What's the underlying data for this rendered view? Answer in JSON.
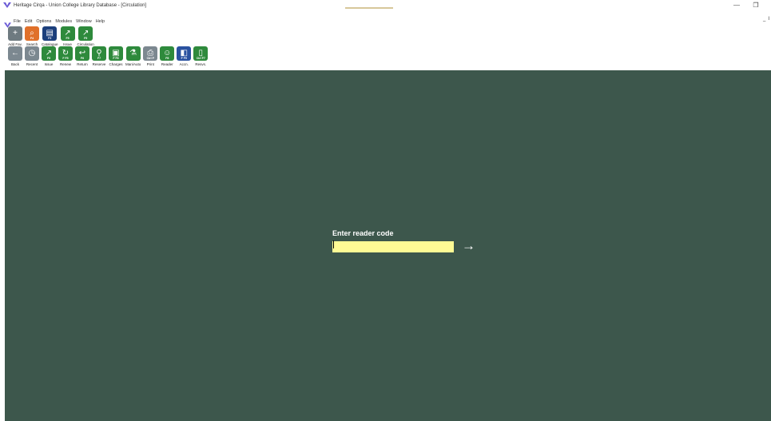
{
  "window": {
    "title": "Heritage Cirqa - Union College Library Database - [Circulation]",
    "app_icon": "heritage-logo-icon",
    "controls": {
      "minimize": "—",
      "restore": "❐"
    },
    "title_progress": 0.5
  },
  "menu": {
    "items": [
      "File",
      "Edit",
      "Options",
      "Modules",
      "Window",
      "Help"
    ],
    "mdi_controls": {
      "minimize": "_",
      "close": "I"
    }
  },
  "toolbar_main": [
    {
      "label": "Add Fav.",
      "key": "",
      "icon": "add-favourite-icon",
      "glyph": "+",
      "color": "grey"
    },
    {
      "label": "Search",
      "key": "F4",
      "icon": "search-icon",
      "glyph": "⌕",
      "color": "orange"
    },
    {
      "label": "Catalogue",
      "key": "F2",
      "icon": "catalogue-book-icon",
      "glyph": "▤",
      "color": "navy"
    },
    {
      "label": "Issue",
      "key": "F5",
      "icon": "issue-arrow-icon",
      "glyph": "↗",
      "color": "green"
    },
    {
      "label": "Circulation",
      "key": "F5",
      "icon": "circulation-arrow-icon",
      "glyph": "↗",
      "color": "green"
    }
  ],
  "toolbar_circ": [
    {
      "label": "Back",
      "key": "",
      "icon": "back-arrow-icon",
      "glyph": "←",
      "color": "slate"
    },
    {
      "label": "Recent",
      "key": "",
      "icon": "recent-clock-icon",
      "glyph": "◷",
      "color": "slate"
    },
    {
      "label": "Issue",
      "key": "F5",
      "icon": "issue-arrow-icon",
      "glyph": "↗",
      "color": "green"
    },
    {
      "label": "Renew",
      "key": "F F5",
      "icon": "renew-icon",
      "glyph": "↻",
      "color": "green"
    },
    {
      "label": "Return",
      "key": "F6",
      "icon": "return-icon",
      "glyph": "↩",
      "color": "green"
    },
    {
      "label": "Reserve",
      "key": "F7",
      "icon": "reserve-pin-icon",
      "glyph": "⚲",
      "color": "green"
    },
    {
      "label": "Charges",
      "key": "F F6",
      "icon": "charges-wallet-icon",
      "glyph": "▣",
      "color": "green"
    },
    {
      "label": "Man/Auto",
      "key": "",
      "icon": "man-auto-flask-icon",
      "glyph": "⚗",
      "color": "green"
    },
    {
      "label": "Print",
      "key": "Ctrl P",
      "icon": "print-icon",
      "glyph": "⎙",
      "color": "slate"
    },
    {
      "label": "Reader",
      "key": "F8",
      "icon": "reader-person-icon",
      "glyph": "☺",
      "color": "green"
    },
    {
      "label": "Accn.",
      "key": "F F9",
      "icon": "accession-icon",
      "glyph": "◧",
      "color": "blue"
    },
    {
      "label": "Resvs.",
      "key": "Ctrl F7",
      "icon": "reservations-icon",
      "glyph": "▯",
      "color": "green"
    }
  ],
  "circulation": {
    "prompt_label": "Enter reader code",
    "input_value": "",
    "input_placeholder": "",
    "submit_icon": "arrow-right-icon",
    "submit_glyph": "→"
  },
  "colors": {
    "workspace_bg": "#3d574c",
    "input_bg": "#fffb95",
    "green": "#2e8a3c",
    "orange": "#e0702a",
    "navy": "#1c3f7c"
  }
}
